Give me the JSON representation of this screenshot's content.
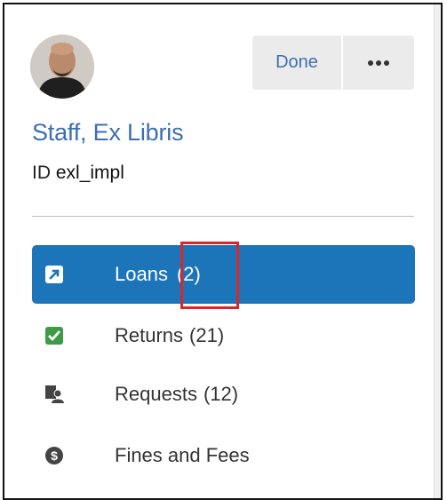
{
  "user": {
    "name": "Staff, Ex Libris",
    "id_prefix": "ID",
    "id_value": "exl_impl"
  },
  "header": {
    "done_label": "Done",
    "more_label": "•••"
  },
  "nav": {
    "items": [
      {
        "label": "Loans",
        "count": "(2)",
        "icon": "external-link-icon",
        "active": true
      },
      {
        "label": "Returns",
        "count": "(21)",
        "icon": "checkbox-check-icon",
        "active": false
      },
      {
        "label": "Requests",
        "count": "(12)",
        "icon": "requests-icon",
        "active": false
      },
      {
        "label": "Fines and Fees",
        "count": "",
        "icon": "dollar-circle-icon",
        "active": false
      }
    ]
  },
  "colors": {
    "accent": "#1d75b9",
    "link": "#3b6fb5",
    "returns_icon": "#3d9a45",
    "highlight": "#e02424"
  }
}
